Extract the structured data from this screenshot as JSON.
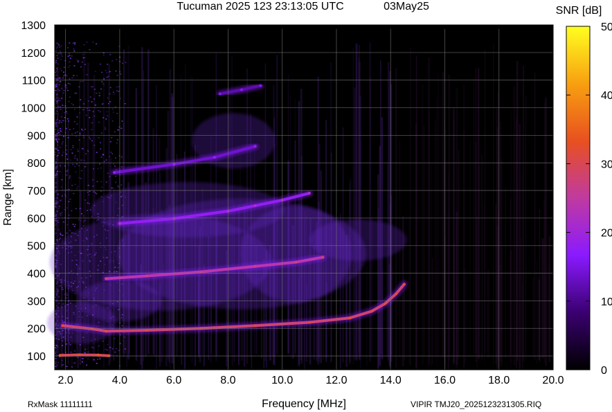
{
  "header": {
    "title": "Tucuman 2025 123 23:13:05 UTC",
    "date": "03May25"
  },
  "footer": {
    "left": "RxMask 11111111",
    "right": "VIPIR  TMJ20_2025123231305.RIQ"
  },
  "colorbar": {
    "label": "SNR [dB]",
    "ticks": [
      "50",
      "40",
      "30",
      "20",
      "10",
      "0"
    ],
    "range": [
      0,
      50
    ],
    "colors": [
      "#000000",
      "#3a0070",
      "#8a1aff",
      "#c03aa0",
      "#e85020",
      "#f8a010",
      "#ffff20"
    ]
  },
  "chart_data": {
    "type": "heatmap",
    "xlabel": "Frequency [MHz]",
    "ylabel": "Range [km]",
    "xlim": [
      1.6,
      20.0
    ],
    "ylim": [
      50,
      1300
    ],
    "x_ticks": [
      "2.0",
      "4.0",
      "6.0",
      "8.0",
      "10.0",
      "12.0",
      "14.0",
      "16.0",
      "18.0",
      "20.0"
    ],
    "y_ticks": [
      "100",
      "200",
      "300",
      "400",
      "500",
      "600",
      "700",
      "800",
      "900",
      "1000",
      "1100",
      "1200",
      "1300"
    ],
    "grid": true,
    "background_color": "#000000",
    "traces": [
      {
        "points": [
          [
            1.8,
            102
          ],
          [
            2.5,
            104
          ],
          [
            3.2,
            103
          ],
          [
            3.6,
            101
          ]
        ],
        "snr": 30
      },
      {
        "points": [
          [
            1.9,
            210
          ],
          [
            3.0,
            198
          ],
          [
            3.5,
            190
          ],
          [
            5.0,
            193
          ],
          [
            7.0,
            200
          ],
          [
            9.0,
            210
          ],
          [
            11.0,
            222
          ],
          [
            12.5,
            238
          ],
          [
            13.3,
            262
          ],
          [
            13.8,
            290
          ],
          [
            14.2,
            325
          ],
          [
            14.5,
            360
          ]
        ],
        "snr": 28
      },
      {
        "points": [
          [
            3.5,
            380
          ],
          [
            5.0,
            390
          ],
          [
            7.0,
            405
          ],
          [
            9.0,
            425
          ],
          [
            10.5,
            440
          ],
          [
            11.5,
            458
          ]
        ],
        "snr": 24
      },
      {
        "points": [
          [
            4.0,
            580
          ],
          [
            6.0,
            598
          ],
          [
            8.0,
            625
          ],
          [
            9.0,
            645
          ],
          [
            10.0,
            665
          ],
          [
            11.0,
            690
          ]
        ],
        "snr": 18
      },
      {
        "points": [
          [
            3.8,
            765
          ],
          [
            6.0,
            795
          ],
          [
            7.5,
            820
          ],
          [
            9.0,
            860
          ]
        ],
        "snr": 14
      },
      {
        "points": [
          [
            7.7,
            1050
          ],
          [
            8.5,
            1065
          ],
          [
            9.2,
            1080
          ]
        ],
        "snr": 12
      }
    ]
  }
}
